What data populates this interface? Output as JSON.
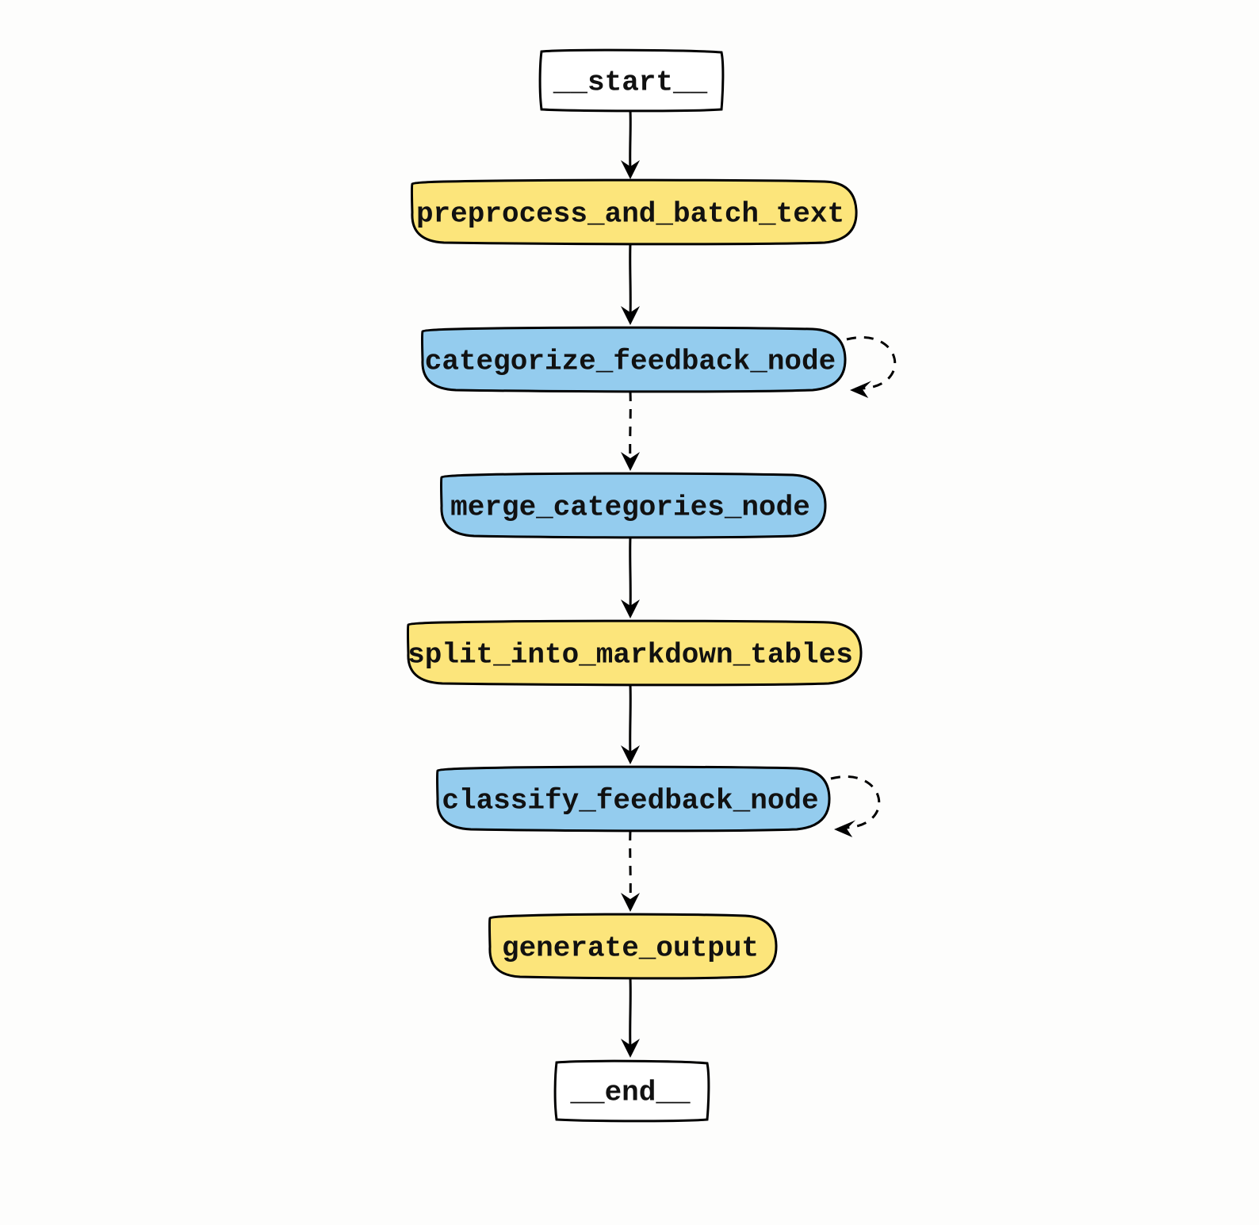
{
  "diagram": {
    "nodes": {
      "start": {
        "label": "__start__",
        "color": "white"
      },
      "preprocess": {
        "label": "preprocess_and_batch_text",
        "color": "yellow"
      },
      "categorize": {
        "label": "categorize_feedback_node",
        "color": "blue",
        "self_loop": true
      },
      "merge": {
        "label": "merge_categories_node",
        "color": "blue"
      },
      "split": {
        "label": "split_into_markdown_tables",
        "color": "yellow"
      },
      "classify": {
        "label": "classify_feedback_node",
        "color": "blue",
        "self_loop": true
      },
      "generate": {
        "label": "generate_output",
        "color": "yellow"
      },
      "end": {
        "label": "__end__",
        "color": "white"
      }
    },
    "edges": [
      {
        "from": "start",
        "to": "preprocess",
        "style": "solid"
      },
      {
        "from": "preprocess",
        "to": "categorize",
        "style": "solid"
      },
      {
        "from": "categorize",
        "to": "merge",
        "style": "dashed"
      },
      {
        "from": "merge",
        "to": "split",
        "style": "solid"
      },
      {
        "from": "split",
        "to": "classify",
        "style": "solid"
      },
      {
        "from": "classify",
        "to": "generate",
        "style": "dashed"
      },
      {
        "from": "generate",
        "to": "end",
        "style": "solid"
      }
    ],
    "colors": {
      "white": "#ffffff",
      "yellow": "#fce57b",
      "blue": "#94ccee",
      "stroke": "#000000"
    }
  }
}
